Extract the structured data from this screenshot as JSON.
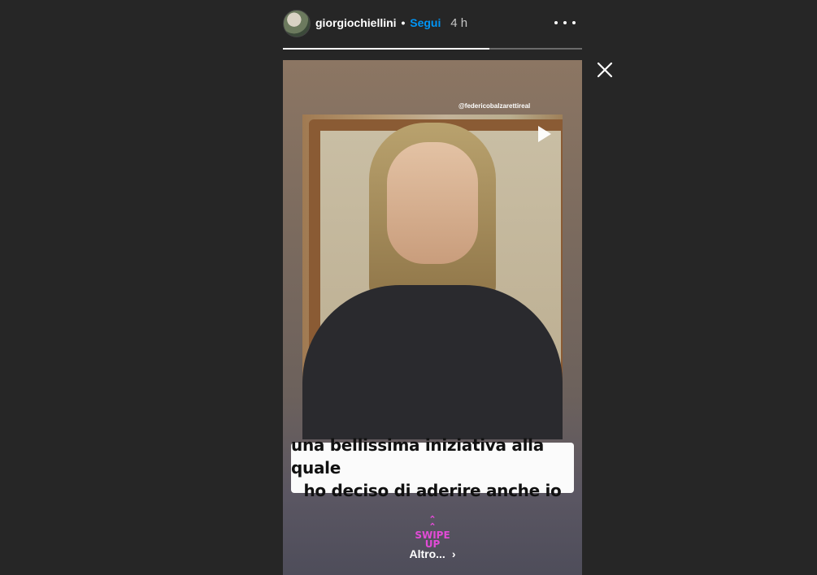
{
  "header": {
    "username": "giorgiochiellini",
    "separator": "•",
    "follow_label": "Segui",
    "time_ago": "4 h"
  },
  "progress": {
    "value": 0.69
  },
  "story": {
    "mention": "@federicobalzarettireal",
    "caption_line1": "una bellissima iniziativa alla quale",
    "caption_line2": "ho deciso di aderire anche io",
    "swipe_arrows": "»",
    "swipe_label": "SWIPE",
    "swipe_label2": "UP",
    "more_label": "Altro...",
    "more_chevron": "›"
  },
  "colors": {
    "accent": "#0095f6",
    "swipe": "#e24bd6",
    "background": "#262626"
  },
  "icons": {
    "more": "more-horizontal-icon",
    "close": "close-icon",
    "play": "play-icon"
  }
}
